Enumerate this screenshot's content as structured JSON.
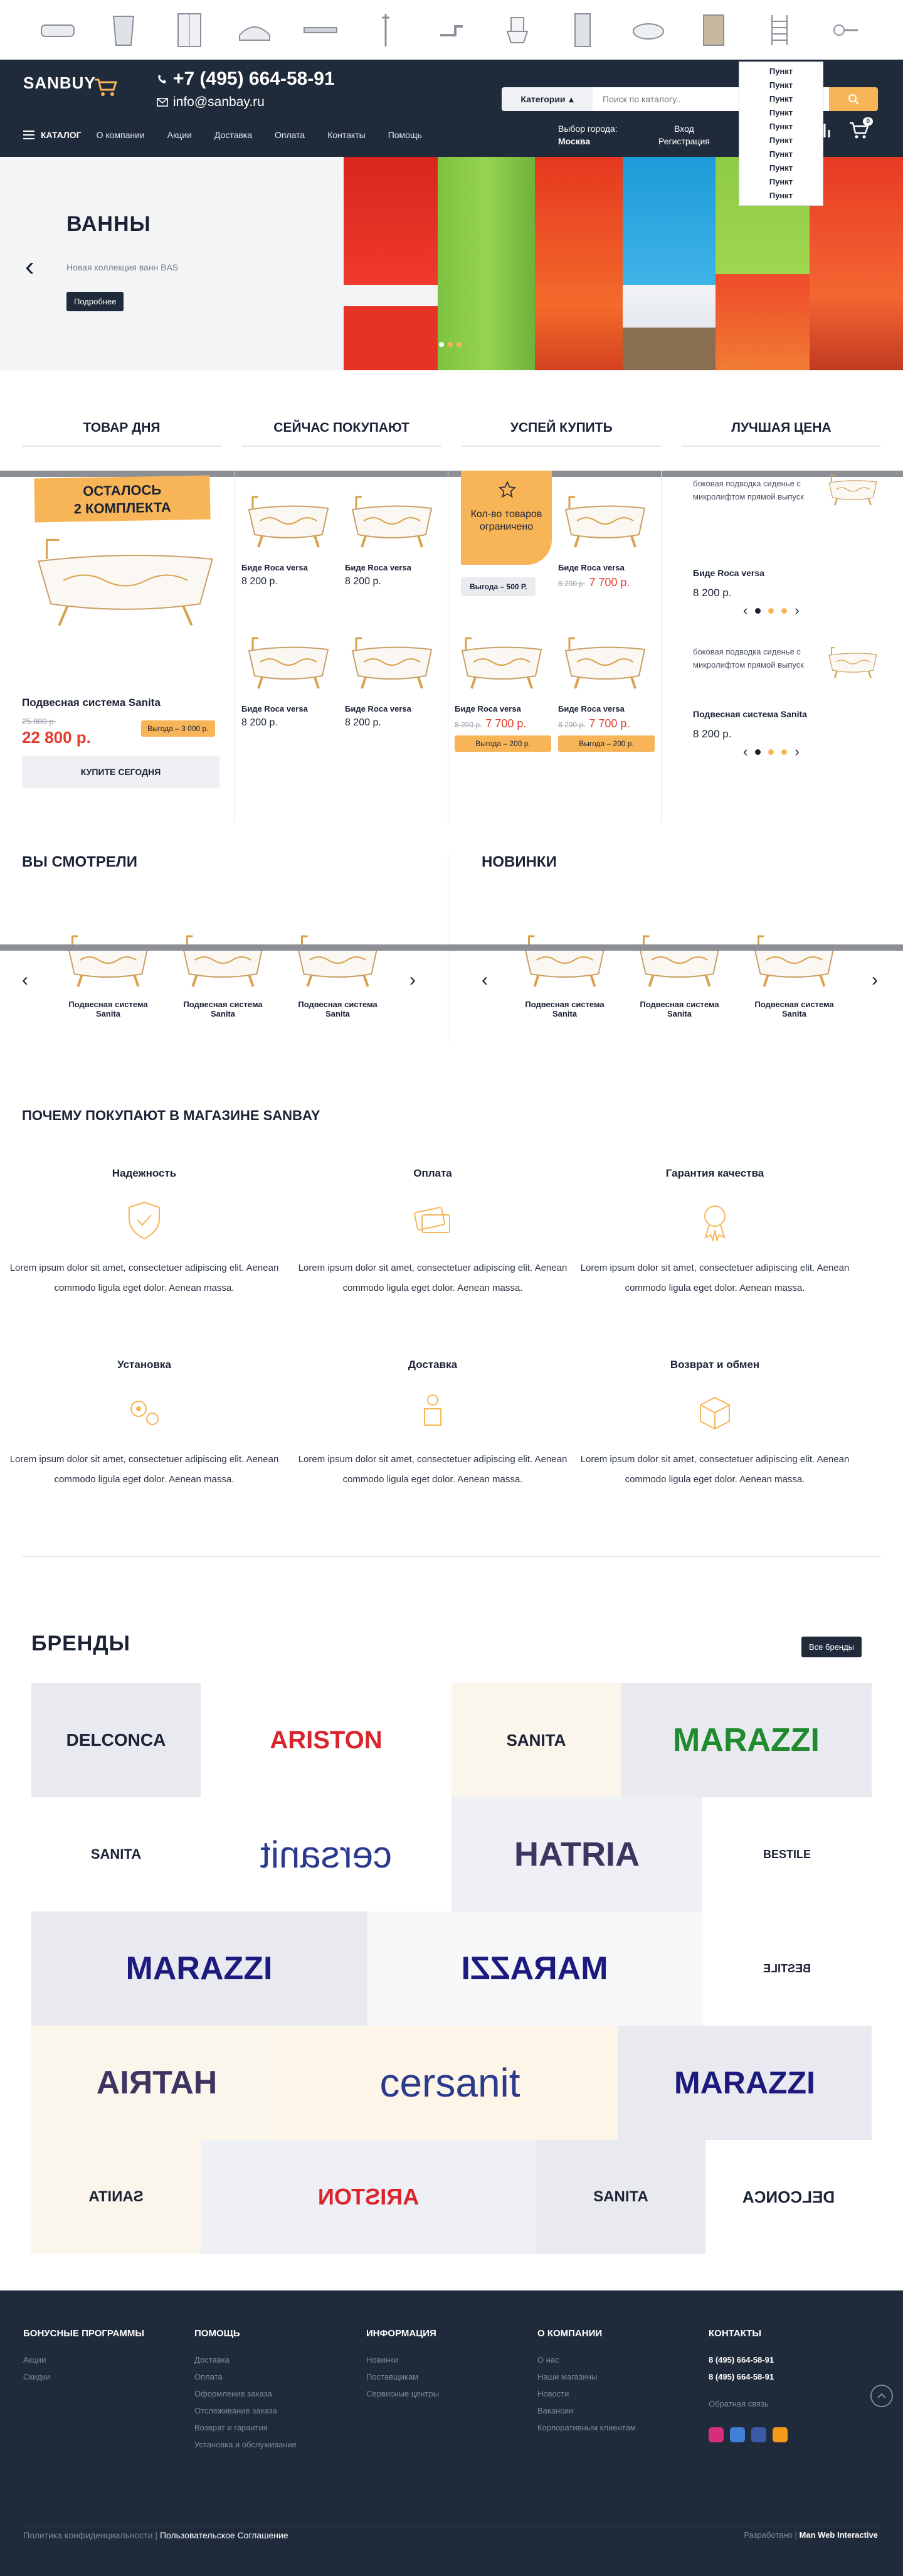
{
  "categories": [
    {
      "icon": "bathtub-icon"
    },
    {
      "icon": "bin-icon"
    },
    {
      "icon": "shower-cabin-icon"
    },
    {
      "icon": "corner-tub-icon"
    },
    {
      "icon": "drain-channel-icon"
    },
    {
      "icon": "shower-rail-icon"
    },
    {
      "icon": "faucet-icon"
    },
    {
      "icon": "toilet-icon"
    },
    {
      "icon": "installation-icon"
    },
    {
      "icon": "sink-icon"
    },
    {
      "icon": "cabinet-icon"
    },
    {
      "icon": "towel-rail-icon"
    },
    {
      "icon": "accessories-icon"
    }
  ],
  "header": {
    "logo": "SANBUY",
    "phone": "+7 (495) 664-58-91",
    "email": "info@sanbay.ru",
    "search_category": "Категории",
    "search_placeholder": "Поиск по каталогу..",
    "nav": {
      "catalog": "КАТАЛОГ",
      "items": [
        "О компании",
        "Акции",
        "Доставка",
        "Оплата",
        "Контакты",
        "Помощь"
      ]
    },
    "city_label": "Выбор города:",
    "city_value": "Москва",
    "login": "Вход",
    "register": "Регистрация",
    "cart_count": "0",
    "dropdown": [
      "Пункт",
      "Пункт",
      "Пункт",
      "Пункт",
      "Пункт",
      "Пункт",
      "Пункт",
      "Пункт",
      "Пункт",
      "Пункт"
    ]
  },
  "hero": {
    "title": "ВАННЫ",
    "subtitle": "Новая коллекция ванн BAS",
    "button": "Подробнее"
  },
  "tabs": [
    "ТОВАР ДНЯ",
    "СЕЙЧАС ПОКУПАЮТ",
    "УСПЕЙ КУПИТЬ",
    "ЛУЧШАЯ ЦЕНА"
  ],
  "deal": {
    "ribbon_line1": "ОСТАЛОСЬ",
    "ribbon_line2": "2 КОМПЛЕКТА",
    "name": "Подвесная система Sanita",
    "old_price": "25 800 р.",
    "price": "22 800 р.",
    "benefit": "Выгода – 3 000 р.",
    "buy": "КУПИТЕ СЕГОДНЯ"
  },
  "buying_now": [
    {
      "name": "Биде Roca versa",
      "price": "8 200 р."
    },
    {
      "name": "Биде Roca versa",
      "price": "8 200 р."
    },
    {
      "name": "Биде Roca versa",
      "price": "8 200 р."
    },
    {
      "name": "Биде Roca versa",
      "price": "8 200 р."
    }
  ],
  "hurry": {
    "promo": "Кол-во товаров ограничено",
    "benefit": "Выгода – 500 Р.",
    "items": [
      {
        "name": "Биде Roca versa",
        "old": "8 200 р.",
        "price": "7 700 р."
      },
      {
        "name": "Биде Roca versa",
        "old": "8 200 р.",
        "price": "7 700 р.",
        "benefit": "Выгода – 200 р."
      },
      {
        "name": "Биде Roca versa",
        "old": "8 200 р.",
        "price": "7 700 р.",
        "benefit": "Выгода – 200 р."
      }
    ]
  },
  "best_price": {
    "items": [
      {
        "desc": "боковая подводка сиденье с микролифтом прямой выпуск",
        "name": "Биде Roca versa",
        "price": "8 200 р."
      },
      {
        "desc": "боковая подводка сиденье с микролифтом прямой выпуск",
        "name": "Подвесная система Sanita",
        "price": "8 200 р."
      }
    ]
  },
  "viewed": {
    "title": "ВЫ СМОТРЕЛИ",
    "items": [
      "Подвесная система Sanita",
      "Подвесная система Sanita",
      "Подвесная система Sanita"
    ]
  },
  "new": {
    "title": "НОВИНКИ",
    "items": [
      "Подвесная система Sanita",
      "Подвесная система Sanita",
      "Подвесная система Sanita"
    ]
  },
  "why": {
    "title": "ПОЧЕМУ ПОКУПАЮТ В МАГАЗИНЕ SANBAY",
    "items": [
      {
        "title": "Надежность",
        "icon": "shield-icon",
        "desc": "Lorem ipsum dolor sit amet, consectetuer adipiscing elit. Aenean commodo ligula eget dolor. Aenean massa."
      },
      {
        "title": "Оплата",
        "icon": "payment-card-icon",
        "desc": "Lorem ipsum dolor sit amet, consectetuer adipiscing elit. Aenean commodo ligula eget dolor. Aenean massa."
      },
      {
        "title": "Гарантия качества",
        "icon": "quality-medal-icon",
        "desc": "Lorem ipsum dolor sit amet, consectetuer adipiscing elit. Aenean commodo ligula eget dolor. Aenean massa."
      },
      {
        "title": "Установка",
        "icon": "gears-icon",
        "desc": "Lorem ipsum dolor sit amet, consectetuer adipiscing elit. Aenean commodo ligula eget dolor. Aenean massa."
      },
      {
        "title": "Доставка",
        "icon": "delivery-icon",
        "desc": "Lorem ipsum dolor sit amet, consectetuer adipiscing elit. Aenean commodo ligula eget dolor. Aenean massa."
      },
      {
        "title": "Возврат и обмен",
        "icon": "return-box-icon",
        "desc": "Lorem ipsum dolor sit amet, consectetuer adipiscing elit. Aenean commodo ligula eget dolor. Aenean massa."
      }
    ]
  },
  "brands": {
    "title": "БРЕНДЫ",
    "all_button": "Все бренды",
    "cells": [
      {
        "name": "DELCONCA",
        "color": "#1b2235",
        "bg": "#e8eaef"
      },
      {
        "name": "ARISTON",
        "color": "#d7262c",
        "bg": "#ffffff"
      },
      {
        "name": "SANITA",
        "color": "#1b2235",
        "bg": "#fbf6ec"
      },
      {
        "name": "MARAZZI",
        "color": "#1f8a2e",
        "bg": "#e8eaef"
      },
      {
        "name": "SANITA",
        "color": "#1b2235",
        "bg": "#ffffff"
      },
      {
        "name": "cersanit",
        "color": "#2b3a8c",
        "bg": "#ffffff"
      },
      {
        "name": "HATRIA",
        "color": "#3b3560",
        "bg": "#eef0f6"
      },
      {
        "name": "BESTILE",
        "color": "#1b2235",
        "bg": "#ffffff"
      },
      {
        "name": "MARAZZI",
        "color": "#1d1a7e",
        "bg": "#e8eaef"
      },
      {
        "name": "MARAZZI",
        "color": "#1d1a7e",
        "bg": "#f6f7f9"
      },
      {
        "name": "BESTILE",
        "color": "#1b2235",
        "bg": "#ffffff"
      },
      {
        "name": "HATRIA",
        "color": "#3b3560",
        "bg": "#fbf6ec"
      },
      {
        "name": "cersanit",
        "color": "#2b3a8c",
        "bg": "#fdf6e8"
      },
      {
        "name": "MARAZZI",
        "color": "#1d1a7e",
        "bg": "#e8eaef"
      },
      {
        "name": "SANITA",
        "color": "#1b2235",
        "bg": "#fbf6ec"
      },
      {
        "name": "ARISTON",
        "color": "#d7262c",
        "bg": "#eef0f6"
      },
      {
        "name": "SANITA",
        "color": "#1b2235",
        "bg": "#e8eaef"
      },
      {
        "name": "DELCONCA",
        "color": "#1b2235",
        "bg": "#ffffff"
      }
    ]
  },
  "footer": {
    "cols": [
      {
        "title": "БОНУСНЫЕ ПРОГРАММЫ",
        "links": [
          "Акции",
          "Скидки"
        ]
      },
      {
        "title": "ПОМОЩЬ",
        "links": [
          "Доставка",
          "Оплата",
          "Оформление заказа",
          "Отслеживание заказа",
          "Возврат и гарантия",
          "Установка и обслуживание"
        ]
      },
      {
        "title": "ИНФОРМАЦИЯ",
        "links": [
          "Новинки",
          "Поставщикам",
          "Сервисные центры"
        ]
      },
      {
        "title": "О КОМПАНИИ",
        "links": [
          "О нас",
          "Наши магазины",
          "Новости",
          "Вакансии",
          "Корпоративным клиентам"
        ]
      }
    ],
    "contacts": {
      "title": "КОНТАКТЫ",
      "phone1": "8 (495) 664-58-91",
      "phone2": "8 (495) 664-58-91",
      "feedback": "Обратная связь"
    },
    "privacy": "Политика конфиденциальности",
    "agreement": "Пользовательское Соглашение",
    "dev_label": "Разработано",
    "dev_name": "Man Web Interactive"
  }
}
